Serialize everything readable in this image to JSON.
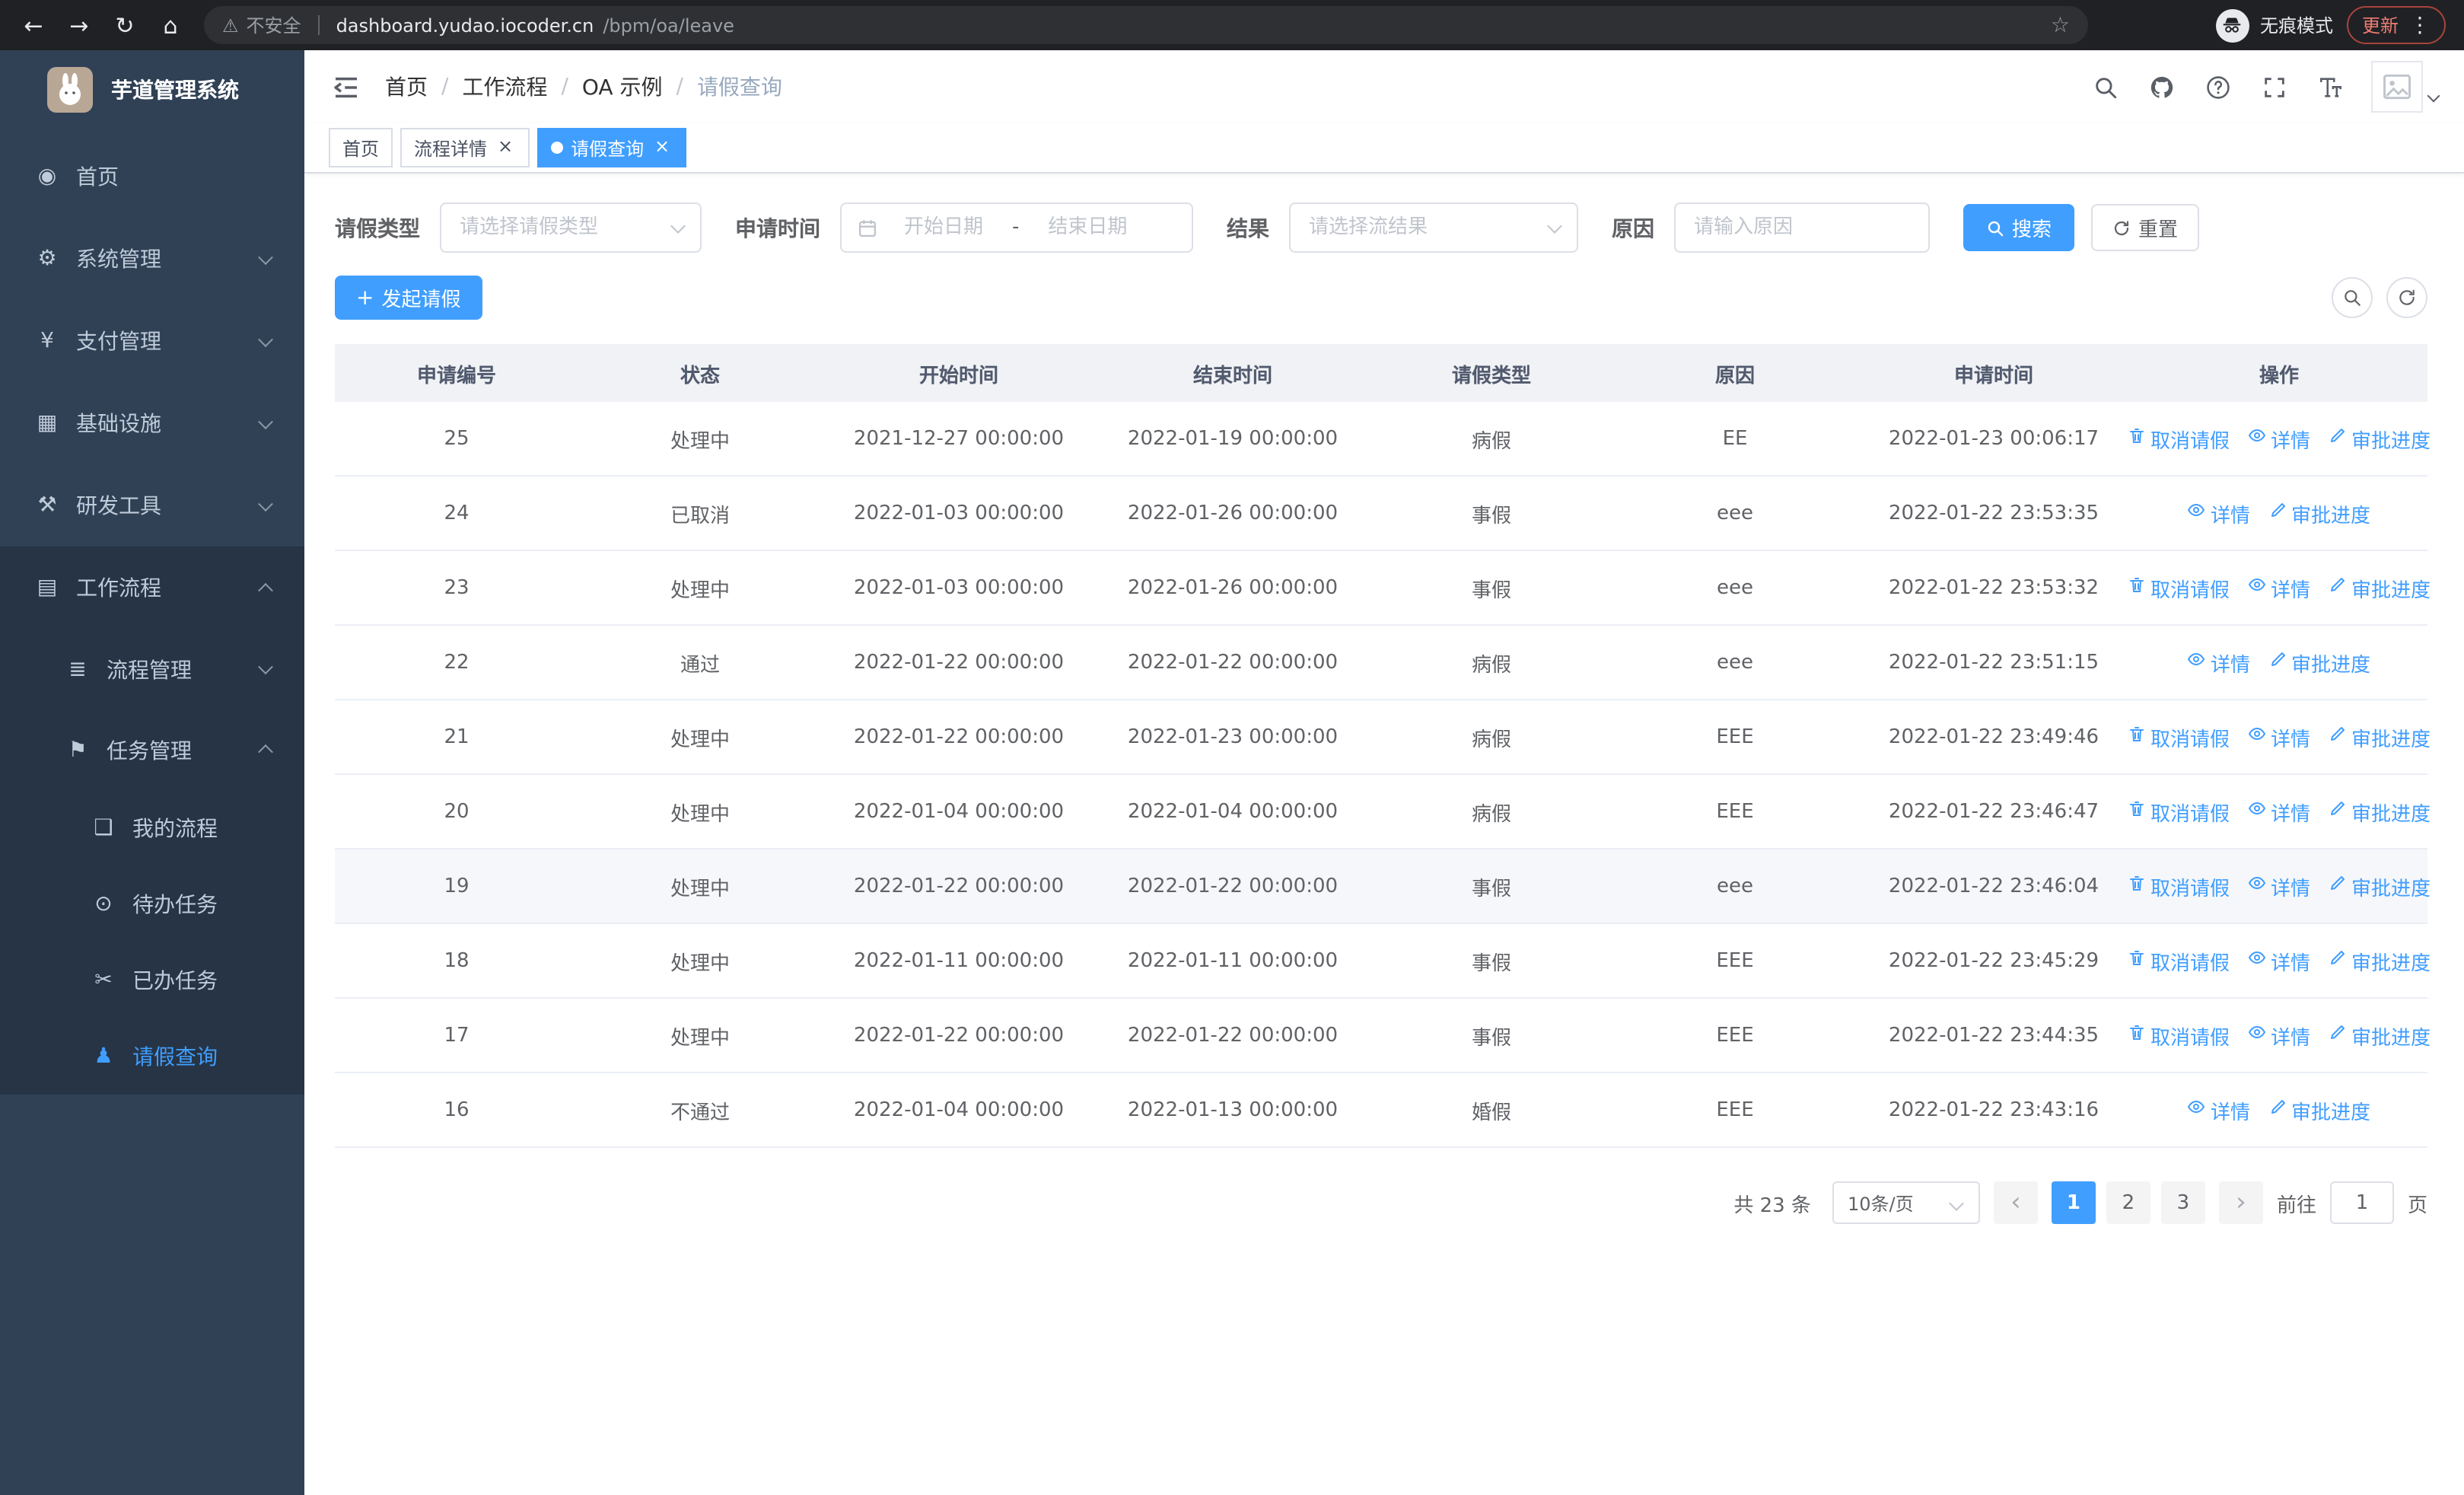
{
  "browser": {
    "security_warning": "不安全",
    "url_domain": "dashboard.yudao.iocoder.cn",
    "url_path": "/bpm/oa/leave",
    "incognito_label": "无痕模式",
    "update_label": "更新"
  },
  "sidebar": {
    "app_title": "芋道管理系统",
    "items": [
      {
        "name": "home",
        "label": "首页",
        "icon": "dashboard-icon",
        "level": 1
      },
      {
        "name": "system-management",
        "label": "系统管理",
        "icon": "gear-icon",
        "level": 1,
        "chevron": "down"
      },
      {
        "name": "payment-management",
        "label": "支付管理",
        "icon": "yen-icon",
        "level": 1,
        "chevron": "down"
      },
      {
        "name": "infrastructure",
        "label": "基础设施",
        "icon": "infrastructure-icon",
        "level": 1,
        "chevron": "down"
      },
      {
        "name": "dev-tools",
        "label": "研发工具",
        "icon": "tools-icon",
        "level": 1,
        "chevron": "down"
      },
      {
        "name": "workflow",
        "label": "工作流程",
        "icon": "workflow-icon",
        "level": 1,
        "chevron": "up",
        "expanded": true
      },
      {
        "name": "process-management",
        "label": "流程管理",
        "icon": "process-list-icon",
        "level": 2,
        "chevron": "down",
        "sub": true
      },
      {
        "name": "task-management",
        "label": "任务管理",
        "icon": "task-flag-icon",
        "level": 2,
        "chevron": "up",
        "sub": true
      },
      {
        "name": "my-process",
        "label": "我的流程",
        "icon": "chat-icon",
        "level": 3,
        "sub": true
      },
      {
        "name": "todo-tasks",
        "label": "待办任务",
        "icon": "eye-icon",
        "level": 3,
        "sub": true
      },
      {
        "name": "done-tasks",
        "label": "已办任务",
        "icon": "scissors-icon",
        "level": 3,
        "sub": true
      },
      {
        "name": "leave-query",
        "label": "请假查询",
        "icon": "user-icon",
        "level": 3,
        "sub": true,
        "active": true
      }
    ]
  },
  "header": {
    "breadcrumb": [
      "首页",
      "工作流程",
      "OA 示例",
      "请假查询"
    ]
  },
  "tabs": [
    {
      "name": "home",
      "label": "首页",
      "closable": false,
      "active": false
    },
    {
      "name": "process-detail",
      "label": "流程详情",
      "closable": true,
      "active": false
    },
    {
      "name": "leave-query",
      "label": "请假查询",
      "closable": true,
      "active": true
    }
  ],
  "filters": {
    "leave_type_label": "请假类型",
    "leave_type_placeholder": "请选择请假类型",
    "apply_time_label": "申请时间",
    "start_placeholder": "开始日期",
    "range_separator": "-",
    "end_placeholder": "结束日期",
    "result_label": "结果",
    "result_placeholder": "请选择流结果",
    "reason_label": "原因",
    "reason_placeholder": "请输入原因",
    "search_label": "搜索",
    "reset_label": "重置"
  },
  "toolbar": {
    "create_label": "发起请假"
  },
  "table": {
    "columns": [
      "申请编号",
      "状态",
      "开始时间",
      "结束时间",
      "请假类型",
      "原因",
      "申请时间",
      "操作"
    ],
    "actions": {
      "cancel": "取消请假",
      "detail": "详情",
      "progress": "审批进度"
    },
    "rows": [
      {
        "id": "25",
        "status": "处理中",
        "start": "2021-12-27 00:00:00",
        "end": "2022-01-19 00:00:00",
        "type": "病假",
        "reason": "EE",
        "apply": "2022-01-23 00:06:17",
        "cancelable": true
      },
      {
        "id": "24",
        "status": "已取消",
        "start": "2022-01-03 00:00:00",
        "end": "2022-01-26 00:00:00",
        "type": "事假",
        "reason": "eee",
        "apply": "2022-01-22 23:53:35",
        "cancelable": false
      },
      {
        "id": "23",
        "status": "处理中",
        "start": "2022-01-03 00:00:00",
        "end": "2022-01-26 00:00:00",
        "type": "事假",
        "reason": "eee",
        "apply": "2022-01-22 23:53:32",
        "cancelable": true
      },
      {
        "id": "22",
        "status": "通过",
        "start": "2022-01-22 00:00:00",
        "end": "2022-01-22 00:00:00",
        "type": "病假",
        "reason": "eee",
        "apply": "2022-01-22 23:51:15",
        "cancelable": false
      },
      {
        "id": "21",
        "status": "处理中",
        "start": "2022-01-22 00:00:00",
        "end": "2022-01-23 00:00:00",
        "type": "病假",
        "reason": "EEE",
        "apply": "2022-01-22 23:49:46",
        "cancelable": true
      },
      {
        "id": "20",
        "status": "处理中",
        "start": "2022-01-04 00:00:00",
        "end": "2022-01-04 00:00:00",
        "type": "病假",
        "reason": "EEE",
        "apply": "2022-01-22 23:46:47",
        "cancelable": true
      },
      {
        "id": "19",
        "status": "处理中",
        "start": "2022-01-22 00:00:00",
        "end": "2022-01-22 00:00:00",
        "type": "事假",
        "reason": "eee",
        "apply": "2022-01-22 23:46:04",
        "cancelable": true,
        "highlight": true
      },
      {
        "id": "18",
        "status": "处理中",
        "start": "2022-01-11 00:00:00",
        "end": "2022-01-11 00:00:00",
        "type": "事假",
        "reason": "EEE",
        "apply": "2022-01-22 23:45:29",
        "cancelable": true
      },
      {
        "id": "17",
        "status": "处理中",
        "start": "2022-01-22 00:00:00",
        "end": "2022-01-22 00:00:00",
        "type": "事假",
        "reason": "EEE",
        "apply": "2022-01-22 23:44:35",
        "cancelable": true
      },
      {
        "id": "16",
        "status": "不通过",
        "start": "2022-01-04 00:00:00",
        "end": "2022-01-13 00:00:00",
        "type": "婚假",
        "reason": "EEE",
        "apply": "2022-01-22 23:43:16",
        "cancelable": false
      }
    ]
  },
  "pagination": {
    "total_label": "共 23 条",
    "page_size_label": "10条/页",
    "pages": [
      "1",
      "2",
      "3"
    ],
    "active_page": "1",
    "goto_label": "前往",
    "goto_value": "1",
    "page_unit": "页"
  },
  "colors": {
    "primary": "#409eff",
    "sidebar_bg": "#304156",
    "sidebar_sub_bg": "#263445",
    "sidebar_text": "#bfcbd9",
    "chrome_bg": "#202124",
    "urlbar_bg": "#2f3033",
    "table_header_bg": "#f0f2f5",
    "border": "#ebeef5",
    "text_secondary": "#97a8be"
  }
}
